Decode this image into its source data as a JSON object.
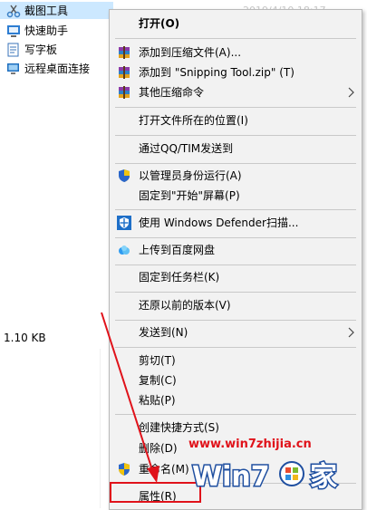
{
  "files": [
    {
      "label": "截图工具",
      "icon": "scissors-icon",
      "selected": true
    },
    {
      "label": "快速助手",
      "icon": "quick-assist-icon",
      "selected": false
    },
    {
      "label": "写字板",
      "icon": "wordpad-icon",
      "selected": false
    },
    {
      "label": "远程桌面连接",
      "icon": "remote-desktop-icon",
      "selected": false
    }
  ],
  "status": {
    "size": "1.10 KB"
  },
  "top_date": "2019/4/10 18:17",
  "context_menu": {
    "open": "打开(O)",
    "add_archive": "添加到压缩文件(A)...",
    "add_zip": "添加到 \"Snipping Tool.zip\" (T)",
    "other_compress": "其他压缩命令",
    "open_location": "打开文件所在的位置(I)",
    "send_qq": "通过QQ/TIM发送到",
    "run_admin": "以管理员身份运行(A)",
    "pin_start": "固定到\"开始\"屏幕(P)",
    "defender_scan": "使用 Windows Defender扫描...",
    "upload_baidu": "上传到百度网盘",
    "pin_taskbar": "固定到任务栏(K)",
    "restore_prev": "还原以前的版本(V)",
    "send_to": "发送到(N)",
    "cut": "剪切(T)",
    "copy": "复制(C)",
    "paste": "粘贴(P)",
    "create_shortcut": "创建快捷方式(S)",
    "delete": "删除(D)",
    "rename": "重命名(M)",
    "properties": "属性(R)"
  },
  "watermark": {
    "url": "www.win7zhijia.cn",
    "logo_text": "Win7",
    "logo_suffix": "家"
  },
  "colors": {
    "highlight": "#e0121a",
    "selection": "#cce8ff",
    "menu_bg": "#f2f2f2"
  }
}
